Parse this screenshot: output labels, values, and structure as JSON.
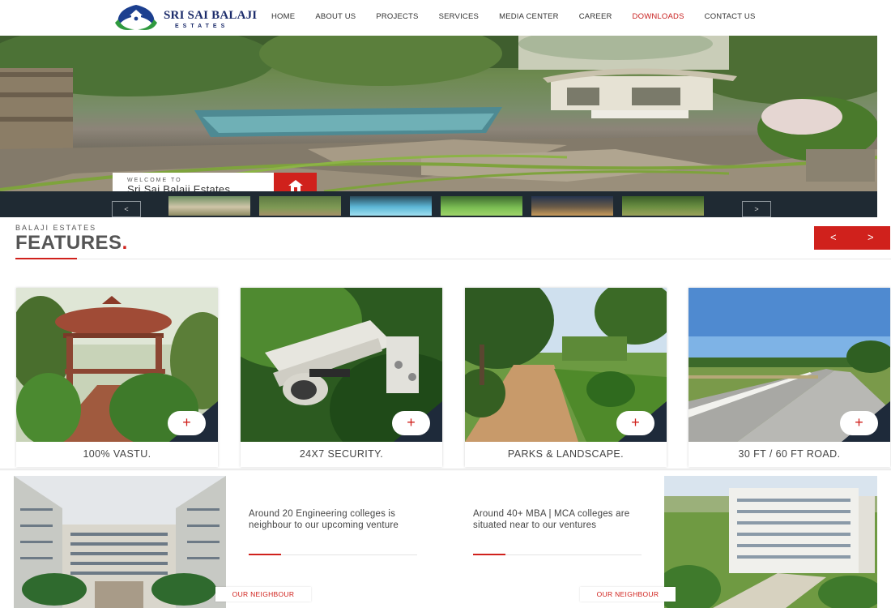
{
  "brand": {
    "name": "SRI SAI BALAJI",
    "sub": "ESTATES"
  },
  "nav": {
    "items": [
      {
        "label": "HOME"
      },
      {
        "label": "ABOUT US"
      },
      {
        "label": "PROJECTS"
      },
      {
        "label": "SERVICES"
      },
      {
        "label": "MEDIA CENTER"
      },
      {
        "label": "CAREER"
      },
      {
        "label": "DOWNLOADS",
        "active": true
      },
      {
        "label": "CONTACT US"
      }
    ]
  },
  "hero": {
    "welcome_small": "WELCOME TO",
    "welcome_title": "Sri Sai Balaji Estates.",
    "home_icon": "home-icon"
  },
  "strip": {
    "prev": "<",
    "next": ">"
  },
  "features": {
    "kicker": "BALAJI ESTATES",
    "title": "FEATURES",
    "title_dot": ".",
    "prev": "<",
    "next": ">",
    "cards": [
      {
        "label": "100% VASTU."
      },
      {
        "label": "24X7 SECURITY."
      },
      {
        "label": "PARKS & LANDSCAPE."
      },
      {
        "label": "30 FT / 60 FT ROAD."
      }
    ],
    "plus": "+"
  },
  "neighbours": {
    "items": [
      {
        "text": "Around 20 Engineering colleges is neighbour to our upcoming venture",
        "badge": "OUR NEIGHBOUR"
      },
      {
        "text": "Around 40+ MBA | MCA colleges are situated near to our ventures",
        "badge": "OUR NEIGHBOUR"
      }
    ]
  },
  "colors": {
    "accent": "#d0211c",
    "dark": "#1f2a33",
    "brand": "#1c2c6b"
  }
}
